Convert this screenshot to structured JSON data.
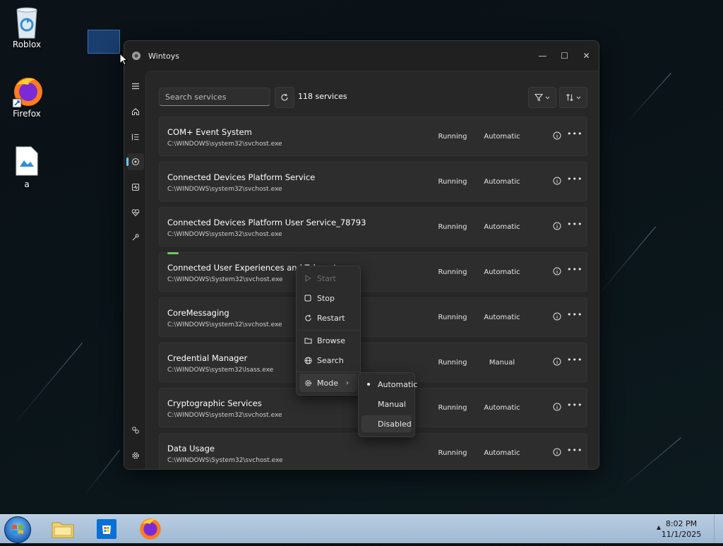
{
  "desktop": {
    "icons": [
      {
        "label": "Roblox",
        "icon": "recycle-bin-icon"
      },
      {
        "label": "Firefox",
        "icon": "firefox-icon"
      },
      {
        "label": "a",
        "icon": "image-file-icon"
      }
    ]
  },
  "window": {
    "title": "Wintoys",
    "controls": {
      "minimize": "—",
      "maximize": "☐",
      "close": "✕"
    }
  },
  "nav": {
    "items": [
      "menu-icon",
      "home-icon",
      "apps-list-icon",
      "services-icon",
      "performance-icon",
      "health-icon",
      "tools-icon",
      "accounts-icon",
      "settings-icon"
    ],
    "active": "services-icon"
  },
  "toolbar": {
    "search_placeholder": "Search services",
    "count": "118 services"
  },
  "services": [
    {
      "name": "COM+ Event System",
      "path": "C:\\WINDOWS\\system32\\svchost.exe",
      "status": "Running",
      "mode": "Automatic"
    },
    {
      "name": "Connected Devices Platform Service",
      "path": "C:\\WINDOWS\\system32\\svchost.exe",
      "status": "Running",
      "mode": "Automatic"
    },
    {
      "name": "Connected Devices Platform User Service_78793",
      "path": "C:\\WINDOWS\\system32\\svchost.exe",
      "status": "Running",
      "mode": "Automatic"
    },
    {
      "name": "Connected User Experiences and Telemetry",
      "path": "C:\\WINDOWS\\System32\\svchost.exe",
      "status": "Running",
      "mode": "Automatic"
    },
    {
      "name": "CoreMessaging",
      "path": "C:\\WINDOWS\\system32\\svchost.exe",
      "status": "Running",
      "mode": "Automatic"
    },
    {
      "name": "Credential Manager",
      "path": "C:\\WINDOWS\\system32\\lsass.exe",
      "status": "Running",
      "mode": "Manual"
    },
    {
      "name": "Cryptographic Services",
      "path": "C:\\WINDOWS\\system32\\svchost.exe",
      "status": "Running",
      "mode": "Automatic"
    },
    {
      "name": "Data Usage",
      "path": "C:\\WINDOWS\\System32\\svchost.exe",
      "status": "Running",
      "mode": "Automatic"
    }
  ],
  "context_menu": {
    "start": "Start",
    "stop": "Stop",
    "restart": "Restart",
    "browse": "Browse",
    "search": "Search",
    "mode": "Mode"
  },
  "mode_submenu": {
    "automatic": "Automatic",
    "manual": "Manual",
    "disabled": "Disabled",
    "selected": "Automatic"
  },
  "taskbar": {
    "time": "8:02 PM",
    "date": "11/1/2025"
  }
}
